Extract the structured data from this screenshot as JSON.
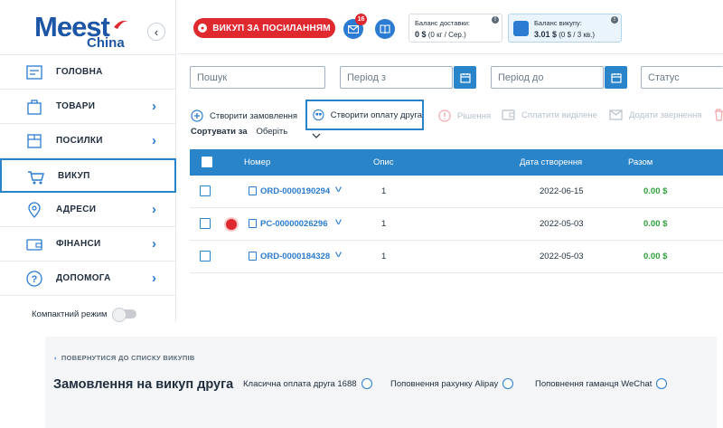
{
  "logo": {
    "brand": "Meest",
    "sub": "China"
  },
  "header": {
    "buy_link_button": "ВИКУП ЗА ПОСИЛАННЯМ",
    "messages_badge": "16",
    "delivery_balance": {
      "title": "Баланс доставки:",
      "amount": "0 $",
      "detail": "(0 кг / Сер.)"
    },
    "buyout_balance": {
      "title": "Баланс викупу:",
      "amount": "3.01 $",
      "detail": "(0 $ / 3 кв.)"
    }
  },
  "sidebar": {
    "items": [
      {
        "label": "ГОЛОВНА",
        "icon": "home-icon",
        "chevron": false
      },
      {
        "label": "ТОВАРИ",
        "icon": "shopping-bag-icon",
        "chevron": true
      },
      {
        "label": "ПОСИЛКИ",
        "icon": "package-icon",
        "chevron": true
      },
      {
        "label": "ВИКУП",
        "icon": "cart-icon",
        "chevron": false,
        "active": true
      },
      {
        "label": "АДРЕСИ",
        "icon": "location-pin-icon",
        "chevron": true
      },
      {
        "label": "ФІНАНСИ",
        "icon": "wallet-icon",
        "chevron": true
      },
      {
        "label": "ДОПОМОГА",
        "icon": "help-icon",
        "chevron": true
      }
    ],
    "compact_mode_label": "Компактний режим",
    "compact_mode_on": false
  },
  "filters": {
    "search_placeholder": "Пошук",
    "period_from_placeholder": "Період з",
    "period_to_placeholder": "Період до",
    "status_placeholder": "Статус"
  },
  "actions": {
    "create_order": "Створити замовлення",
    "create_friend_payment": "Створити оплату друга",
    "solutions": "Рішення",
    "pay_selected": "Сплатити виділене",
    "add_request": "Додати звернення"
  },
  "sort": {
    "label": "Сортувати за",
    "value": "Оберіть"
  },
  "table": {
    "columns": [
      "Номер",
      "Опис",
      "Дата створення",
      "Разом"
    ],
    "rows": [
      {
        "number": "ORD-0000190294",
        "desc": "1",
        "date": "2022-06-15",
        "total": "0.00 $",
        "linked": false
      },
      {
        "number": "PC-00000026296",
        "desc": "1",
        "date": "2022-05-03",
        "total": "0.00 $",
        "linked": true
      },
      {
        "number": "ORD-0000184328",
        "desc": "1",
        "date": "2022-05-03",
        "total": "0.00 $",
        "linked": false
      }
    ]
  },
  "friend_panel": {
    "back_link": "ПОВЕРНУТИСЯ ДО СПИСКУ ВИКУПІВ",
    "title": "Замовлення на викуп друга",
    "options": [
      "Класична оплата друга 1688",
      "Поповнення рахунку Alipay",
      "Поповнення гаманця WeChat"
    ]
  },
  "colors": {
    "accent": "#2a84c9",
    "brand_red": "#e0282f",
    "amount_green": "#2e9e3a"
  }
}
